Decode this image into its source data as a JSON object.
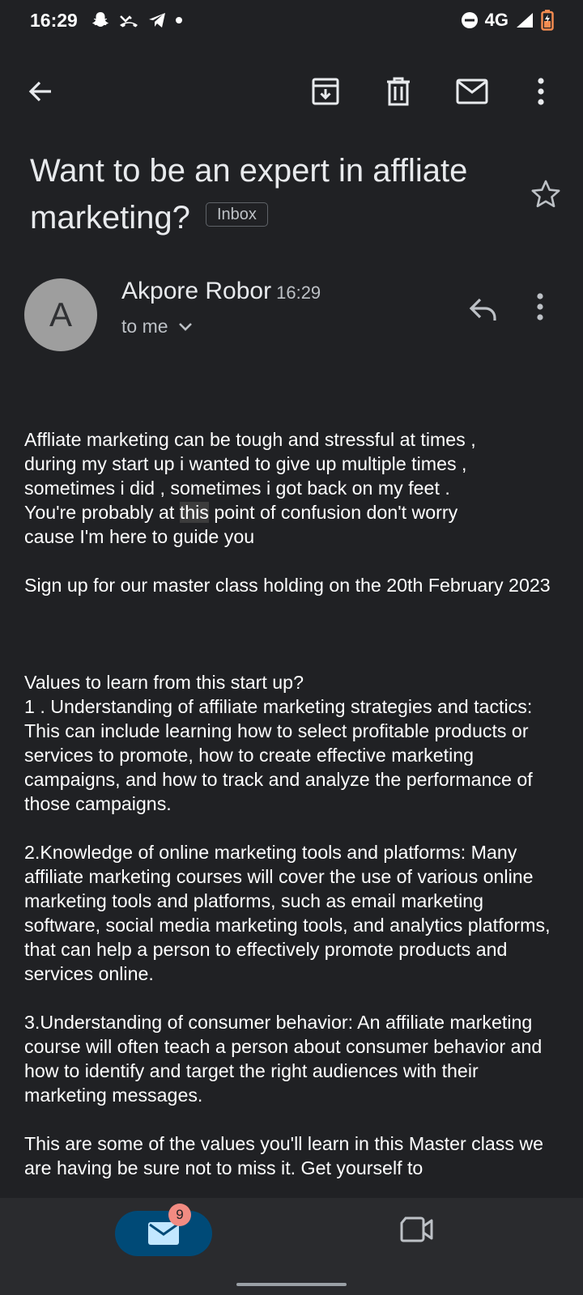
{
  "status_bar": {
    "time": "16:29",
    "left_icons": [
      "snapchat-icon",
      "missed-call-icon",
      "telegram-icon",
      "dot-icon"
    ],
    "network": "4G",
    "right_icons": [
      "dnd-icon",
      "signal-icon",
      "battery-icon"
    ]
  },
  "toolbar": {
    "icons": [
      "back-arrow-icon",
      "archive-icon",
      "trash-icon",
      "mail-icon",
      "more-vert-icon"
    ]
  },
  "email": {
    "subject": "Want to be an expert in affliate marketing?",
    "label": "Inbox",
    "sender_initial": "A",
    "sender_name": "Akpore Robor",
    "time": "16:29",
    "recipient": "to me",
    "body": {
      "p1_before": "Affliate marketing can be tough and stressful at times ,\nduring my start up i wanted to give up multiple times ,\nsometimes i did , sometimes i got back on my feet .\nYou're probably at ",
      "p1_highlight": "this",
      "p1_after": " point of confusion don't worry\ncause I'm here to guide you",
      "p2": "Sign up for our master class holding on the 20th February 2023",
      "p3": "Values to learn from this start up?\n1 . Understanding of affiliate marketing strategies and tactics: This can include learning how to select profitable products or services to promote, how to create effective marketing campaigns, and how to track and analyze the performance of those campaigns.",
      "p4": "2.Knowledge of online marketing tools and platforms: Many affiliate marketing courses will cover the use of various online marketing tools and platforms, such as email marketing software, social media marketing tools, and analytics platforms, that can help a person to effectively promote products and services online.",
      "p5": "3.Understanding of consumer behavior: An affiliate marketing course will often teach a person about consumer behavior and how to identify and target the right audiences with their marketing messages.",
      "p6": "This are some of the values you'll learn in this Master class we are having be sure not to miss it. Get yourself to"
    }
  },
  "bottom_nav": {
    "mail_badge": "9",
    "colors": {
      "pill": "#004a77",
      "badge": "#f28b82"
    }
  }
}
